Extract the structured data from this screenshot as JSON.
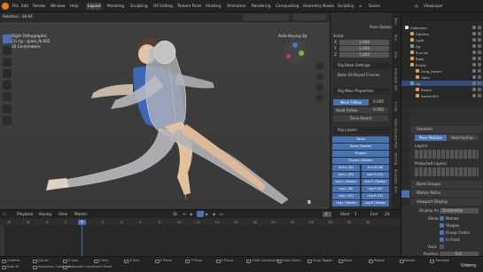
{
  "app": {
    "title": "Scene",
    "viewlayer": "ViewLayer",
    "rotation": "Rotation: -18.94"
  },
  "menu": [
    "File",
    "Edit",
    "Render",
    "Window",
    "Help"
  ],
  "workspaces": [
    "Layout",
    "Modeling",
    "Sculpting",
    "UV Editing",
    "Texture Paint",
    "Shading",
    "Animation",
    "Rendering",
    "Compositing",
    "Geometry Nodes",
    "Scripting"
  ],
  "viewport": {
    "view_name": "Right Orthographic",
    "object": "(2) rig : spine_fk.002",
    "scale": "10 Centimeters",
    "auto_keying": "Auto Keying Op",
    "r_label": "R"
  },
  "npanel": {
    "pose_options": "Pose Options",
    "scale_label": "Scale:",
    "scale_x": "X",
    "scale_x_val": "1.000",
    "scale_y": "Y",
    "scale_y_val": "1.000",
    "scale_z": "Z",
    "scale_z_val": "1.000",
    "bake_settings": "Rig Bake Settings",
    "bake_all": "Bake All Keyed Frames",
    "rig_main": "Rig Main Properties",
    "neck_follow": "Neck Follow",
    "neck_val": "0.000",
    "head_follow": "Head Follow",
    "head_val": "0.000",
    "torso_parent": "Torso Parent",
    "rig_layers": "Rig Layers",
    "layers": [
      "Torso",
      "Torso (Tweak)",
      "Fingers",
      "Fingers (Detail)",
      "Arm.L (IK)",
      "Arm.R (IK)",
      "Arm.L (FK)",
      "Arm.R (FK)",
      "Arm.L (Tweak)",
      "Arm.R (Tweak)",
      "Leg.L (IK)",
      "Leg.R (IK)",
      "Leg.L (FK)",
      "Leg.R (FK)",
      "Leg.L (Tweak)",
      "Leg.R (Tweak)"
    ],
    "side_tabs": [
      "Item",
      "Tool",
      "View",
      "Animation",
      "Edit",
      "Create",
      "Rigify Tools",
      "Rig Main",
      "Shading",
      "BoneAtlas",
      "Item"
    ]
  },
  "outliner": {
    "items": [
      "Collection",
      "Camera",
      "Light",
      "rig",
      "Sun.fall",
      "Body",
      "Empty",
      "Long_Sword",
      "Hairs",
      "rig",
      "Sword",
      "Sword.001"
    ]
  },
  "properties": {
    "skeleton": "Skeleton",
    "pose_position": "Pose Position",
    "rest_position": "Rest Position",
    "layers": "Layers:",
    "protected_layers": "Protected Layers:",
    "bone_groups": "Bone Groups",
    "motion_paths": "Motion Paths",
    "viewport_display": "Viewport Display",
    "display_as": "Display As",
    "display_val": "Octahedral",
    "show": "Show",
    "names": "Names",
    "shapes": "Shapes",
    "group_colors": "Group Colors",
    "in_front": "In Front",
    "axes": "Axes",
    "position": "Position",
    "pos_val": "0.0"
  },
  "timeline": {
    "menus": [
      "Playback",
      "Keying",
      "View",
      "Marker"
    ],
    "current_frame": "6",
    "start_label": "Start",
    "start": "1",
    "end_label": "End",
    "end": "24",
    "ticks": [
      "-8",
      "-6",
      "-4",
      "-2",
      "0",
      "2",
      "4",
      "6",
      "8",
      "10",
      "12",
      "14",
      "16",
      "18",
      "20",
      "22",
      "24",
      "26",
      "28",
      "30"
    ]
  },
  "status": {
    "items": [
      "Confirm",
      "Cancel",
      "X Axis",
      "Y Axis",
      "Z Axis",
      "X Plane",
      "Y Plane",
      "Z Plane",
      "Clear Constraints",
      "Snap Invert",
      "Snap Toggle",
      "Move",
      "Rotate",
      "Resize",
      "Trackball",
      "Auto IK",
      "Automatic Constraint",
      "Automatic Constraint Plane"
    ],
    "brand": "Udemy"
  }
}
